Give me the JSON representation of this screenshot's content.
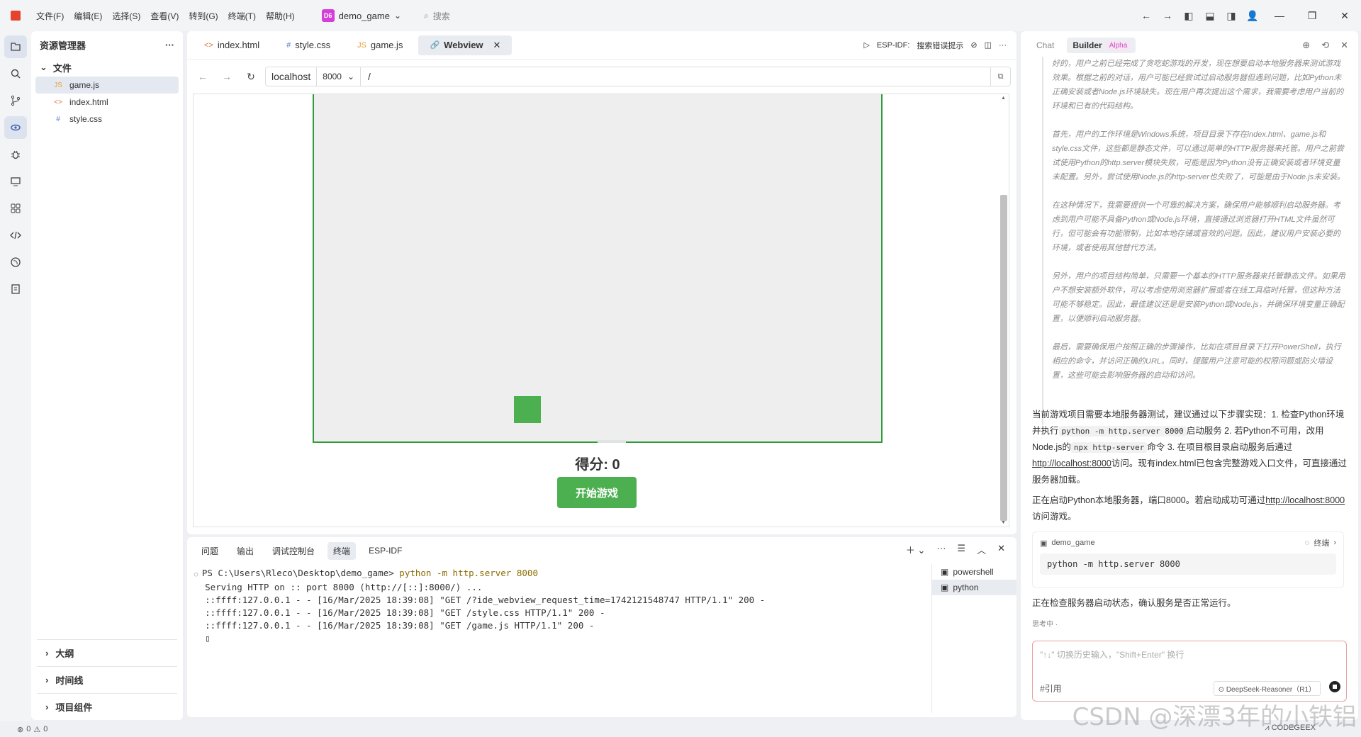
{
  "titlebar": {
    "menus": [
      "文件(F)",
      "编辑(E)",
      "选择(S)",
      "查看(V)",
      "转到(G)",
      "终端(T)",
      "帮助(H)"
    ],
    "workspace_badge": "D6",
    "workspace_name": "demo_game",
    "search_placeholder": "搜索"
  },
  "explorer": {
    "title": "资源管理器",
    "section_files": "文件",
    "files": [
      {
        "icon": "JS",
        "name": "game.js"
      },
      {
        "icon": "<>",
        "name": "index.html"
      },
      {
        "icon": "#",
        "name": "style.css"
      }
    ],
    "bottom_sections": [
      "大纲",
      "时间线",
      "项目组件"
    ]
  },
  "editor": {
    "tabs": [
      {
        "icon": "<>",
        "label": "index.html"
      },
      {
        "icon": "#",
        "label": "style.css"
      },
      {
        "icon": "JS",
        "label": "game.js"
      },
      {
        "icon": "🔗",
        "label": "Webview"
      }
    ],
    "esp_label": "ESP-IDF:",
    "esp_search": "搜索错误提示",
    "url": {
      "host": "localhost",
      "port": "8000",
      "path": "/"
    }
  },
  "game": {
    "score_label": "得分: 0",
    "start_button": "开始游戏"
  },
  "panel": {
    "tabs": [
      "问题",
      "输出",
      "调试控制台",
      "终端",
      "ESP-IDF"
    ],
    "terminal_lines": [
      "PS C:\\Users\\Rleco\\Desktop\\demo_game> ",
      "Serving HTTP on :: port 8000 (http://[::]:8000/) ...",
      "::ffff:127.0.0.1 - - [16/Mar/2025 18:39:08] \"GET /?ide_webview_request_time=1742121548747 HTTP/1.1\" 200 -",
      "::ffff:127.0.0.1 - - [16/Mar/2025 18:39:08] \"GET /style.css HTTP/1.1\" 200 -",
      "::ffff:127.0.0.1 - - [16/Mar/2025 18:39:08] \"GET /game.js HTTP/1.1\" 200 -"
    ],
    "terminal_command": "python -m http.server 8000",
    "terminals": [
      "powershell",
      "python"
    ]
  },
  "chat": {
    "tabs": [
      "Chat",
      "Builder"
    ],
    "alpha_badge": "Alpha",
    "thinking": [
      "好的，用户之前已经完成了贪吃蛇游戏的开发，现在想要启动本地服务器来测试游戏效果。根据之前的对话，用户可能已经尝试过启动服务器但遇到问题，比如Python未正确安装或者Node.js环境缺失。现在用户再次提出这个需求，我需要考虑用户当前的环境和已有的代码结构。",
      "首先，用户的工作环境是Windows系统，项目目录下存在index.html、game.js和style.css文件，这些都是静态文件，可以通过简单的HTTP服务器来托管。用户之前尝试使用Python的http.server模块失败，可能是因为Python没有正确安装或者环境变量未配置。另外，尝试使用Node.js的http-server也失败了，可能是由于Node.js未安装。",
      "在这种情况下，我需要提供一个可靠的解决方案，确保用户能够顺利启动服务器。考虑到用户可能不具备Python或Node.js环境，直接通过浏览器打开HTML文件虽然可行，但可能会有功能限制，比如本地存储或音效的问题。因此，建议用户安装必要的环境，或者使用其他替代方法。",
      "另外，用户的项目结构简单，只需要一个基本的HTTP服务器来托管静态文件。如果用户不想安装额外软件，可以考虑使用浏览器扩展或者在线工具临时托管，但这种方法可能不够稳定。因此，最佳建议还是是安装Python或Node.js，并确保环境变量正确配置，以便顺利启动服务器。",
      "最后，需要确保用户按照正确的步骤操作，比如在项目目录下打开PowerShell，执行相应的命令，并访问正确的URL。同时，提醒用户注意可能的权限问题或防火墙设置，这些可能会影响服务器的启动和访问。"
    ],
    "answer_1_a": "当前游戏项目需要本地服务器测试，建议通过以下步骤实现：1. 检查Python环境并执行",
    "answer_1_code1": "python -m http.server 8000",
    "answer_1_b": "启动服务 2. 若Python不可用，改用Node.js的",
    "answer_1_code2": "npx http-server",
    "answer_1_c": "命令 3. 在项目根目录启动服务后通过",
    "answer_1_link": "http://localhost:8000",
    "answer_1_d": "访问。现有index.html已包含完整游戏入口文件，可直接通过服务器加载。",
    "answer_2_a": "正在启动Python本地服务器，端口8000。若启动成功可通过",
    "answer_2_link": "http://localhost:8000",
    "answer_2_b": "访问游戏。",
    "card_project": "demo_game",
    "card_terminal": "终端",
    "card_command": "python -m http.server 8000",
    "status_text": "正在检查服务器启动状态，确认服务是否正常运行。",
    "thinking_label": "思考中",
    "input_placeholder": "\"↑↓\" 切换历史输入，\"Shift+Enter\" 换行",
    "input_ref": "#引用",
    "model": "DeepSeek-Reasoner（R1）"
  },
  "statusbar": {
    "errors": "0",
    "warnings": "0",
    "brand": "CODEGEEX"
  },
  "watermark": "CSDN @深漂3年的小铁铝"
}
